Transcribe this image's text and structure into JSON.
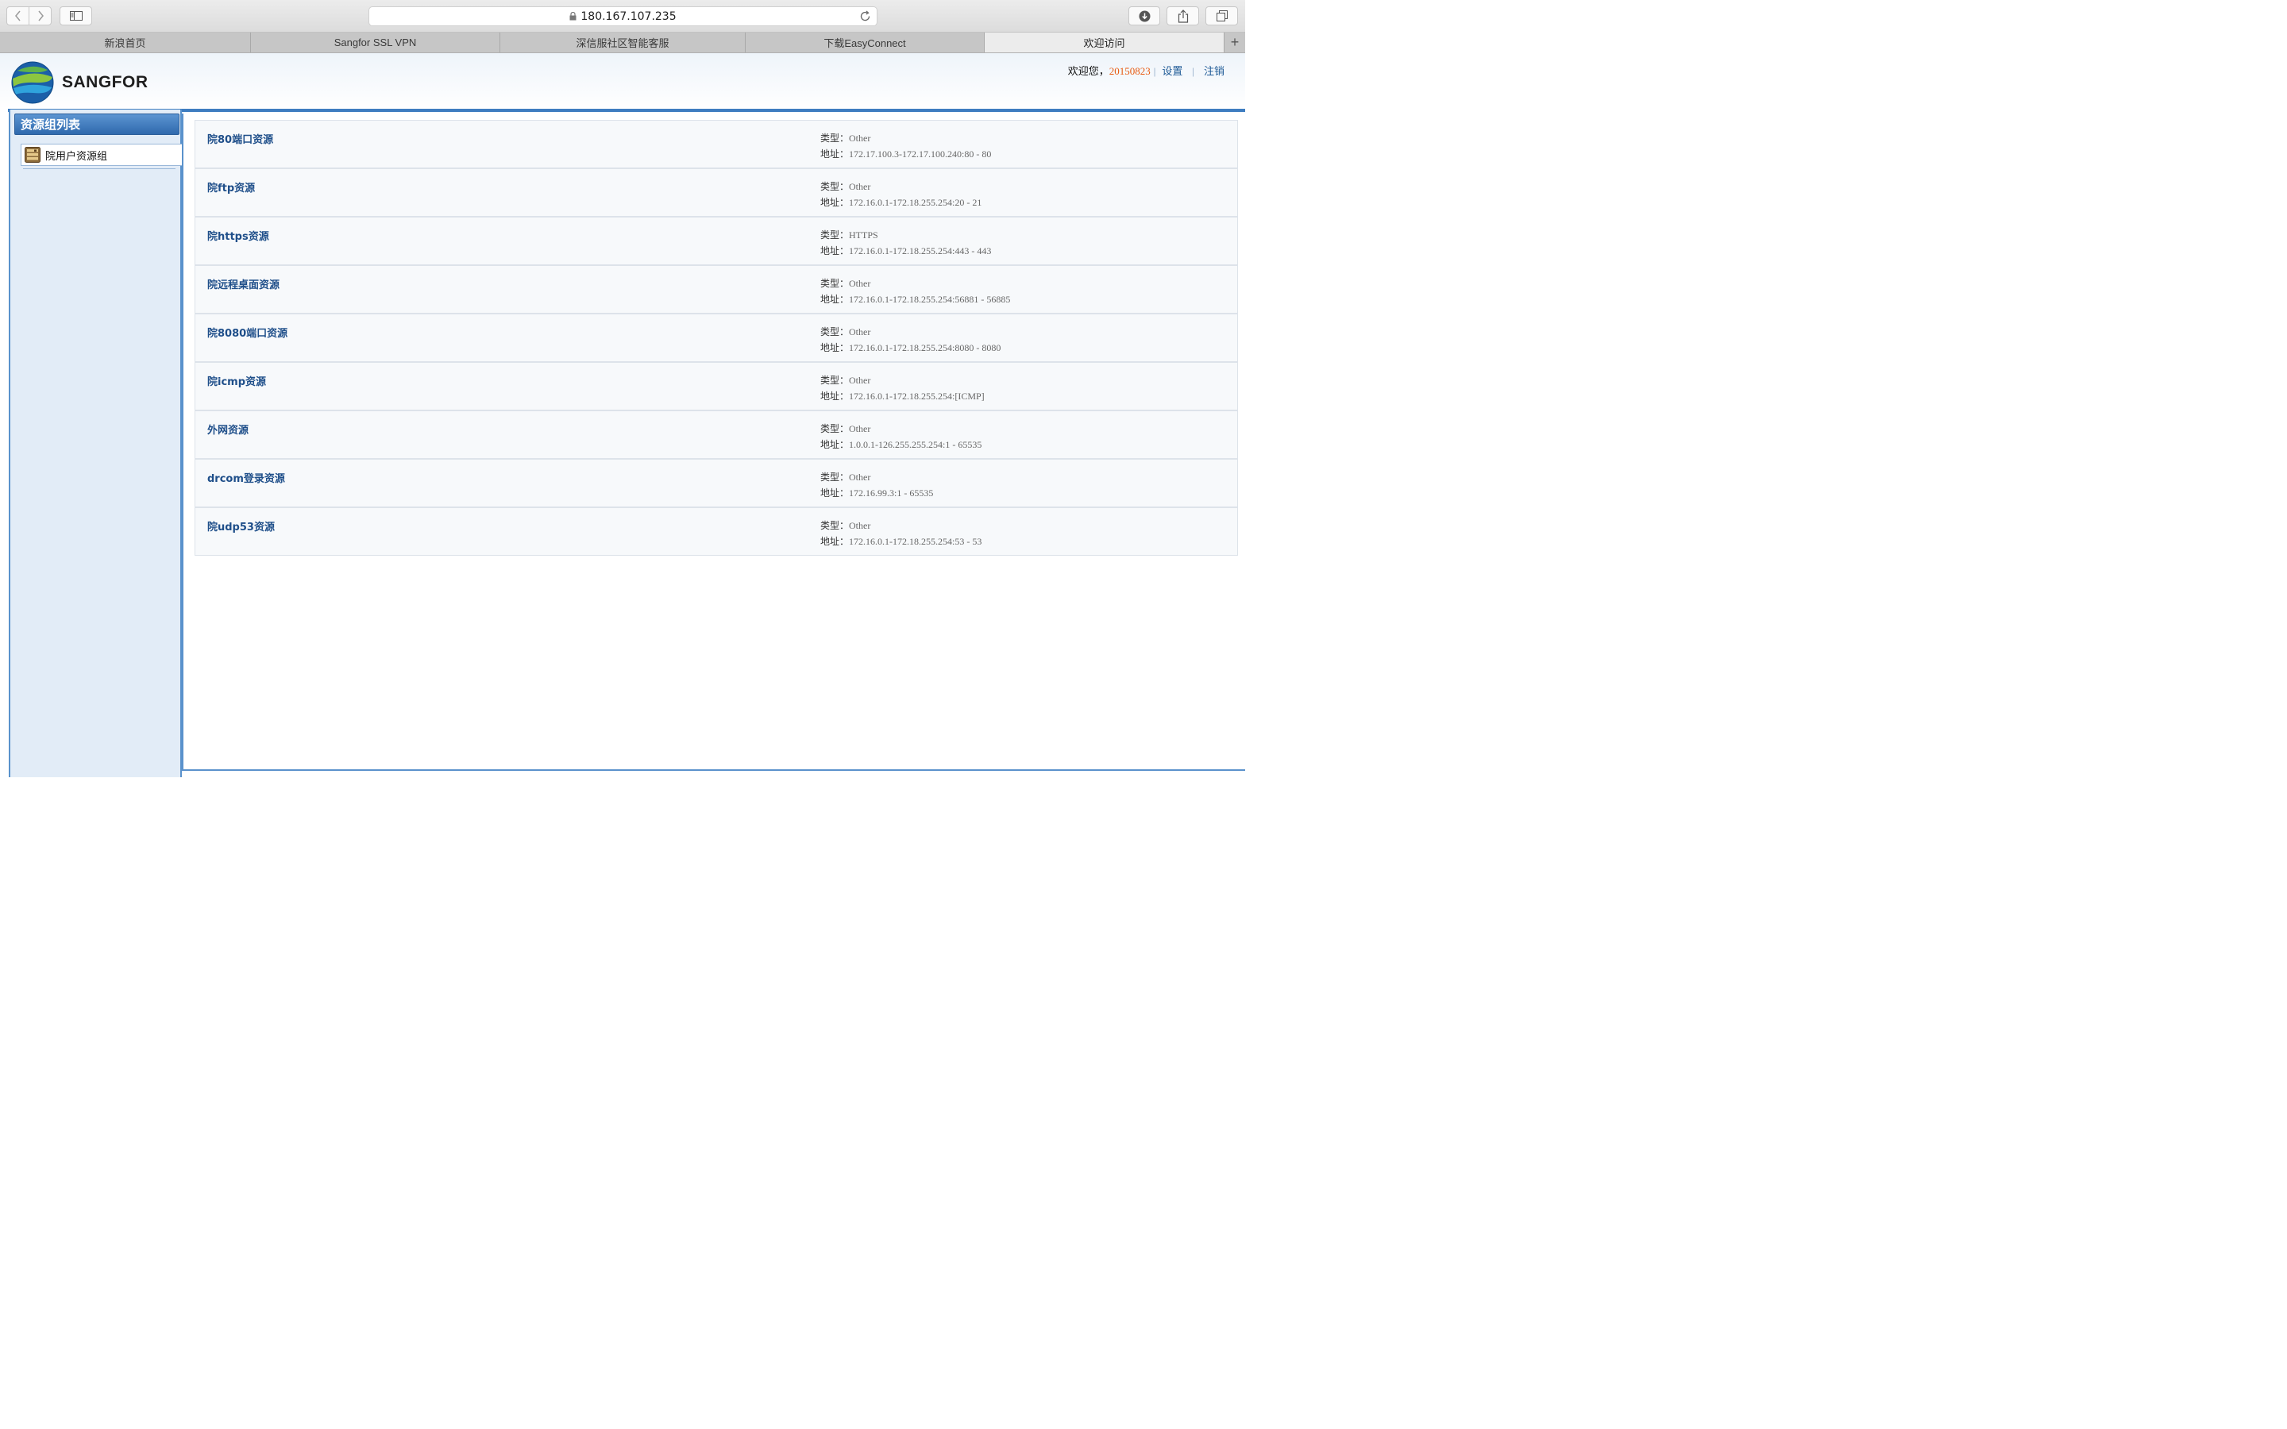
{
  "browser": {
    "address": "180.167.107.235",
    "tabs": [
      {
        "label": "新浪首页",
        "active": false
      },
      {
        "label": "Sangfor SSL VPN",
        "active": false
      },
      {
        "label": "深信服社区智能客服",
        "active": false
      },
      {
        "label": "下载EasyConnect",
        "active": false
      },
      {
        "label": "欢迎访问",
        "active": true
      }
    ],
    "new_tab": "+"
  },
  "header": {
    "logo_text": "SANGFOR",
    "welcome": "欢迎您，",
    "username": "20150823",
    "settings": "设置",
    "logout": "注销",
    "separator": "|"
  },
  "sidebar": {
    "title": "资源组列表",
    "items": [
      {
        "label": "院用户资源组"
      }
    ]
  },
  "labels": {
    "type": "类型：",
    "address": "地址："
  },
  "resources": [
    {
      "name": "院80端口资源",
      "type": "Other",
      "address": "172.17.100.3-172.17.100.240:80 - 80"
    },
    {
      "name": "院ftp资源",
      "type": "Other",
      "address": "172.16.0.1-172.18.255.254:20 - 21"
    },
    {
      "name": "院https资源",
      "type": "HTTPS",
      "address": "172.16.0.1-172.18.255.254:443 - 443"
    },
    {
      "name": "院远程桌面资源",
      "type": "Other",
      "address": "172.16.0.1-172.18.255.254:56881 - 56885"
    },
    {
      "name": "院8080端口资源",
      "type": "Other",
      "address": "172.16.0.1-172.18.255.254:8080 - 8080"
    },
    {
      "name": "院icmp资源",
      "type": "Other",
      "address": "172.16.0.1-172.18.255.254:[ICMP]"
    },
    {
      "name": "外网资源",
      "type": "Other",
      "address": "1.0.0.1-126.255.255.254:1 - 65535"
    },
    {
      "name": "drcom登录资源",
      "type": "Other",
      "address": "172.16.99.3:1 - 65535"
    },
    {
      "name": "院udp53资源",
      "type": "Other",
      "address": "172.16.0.1-172.18.255.254:53 - 53"
    }
  ],
  "colors": {
    "accent": "#3e7dc0",
    "link": "#1e5a96",
    "username": "#e85a10",
    "resource_name": "#1f4f8a"
  }
}
